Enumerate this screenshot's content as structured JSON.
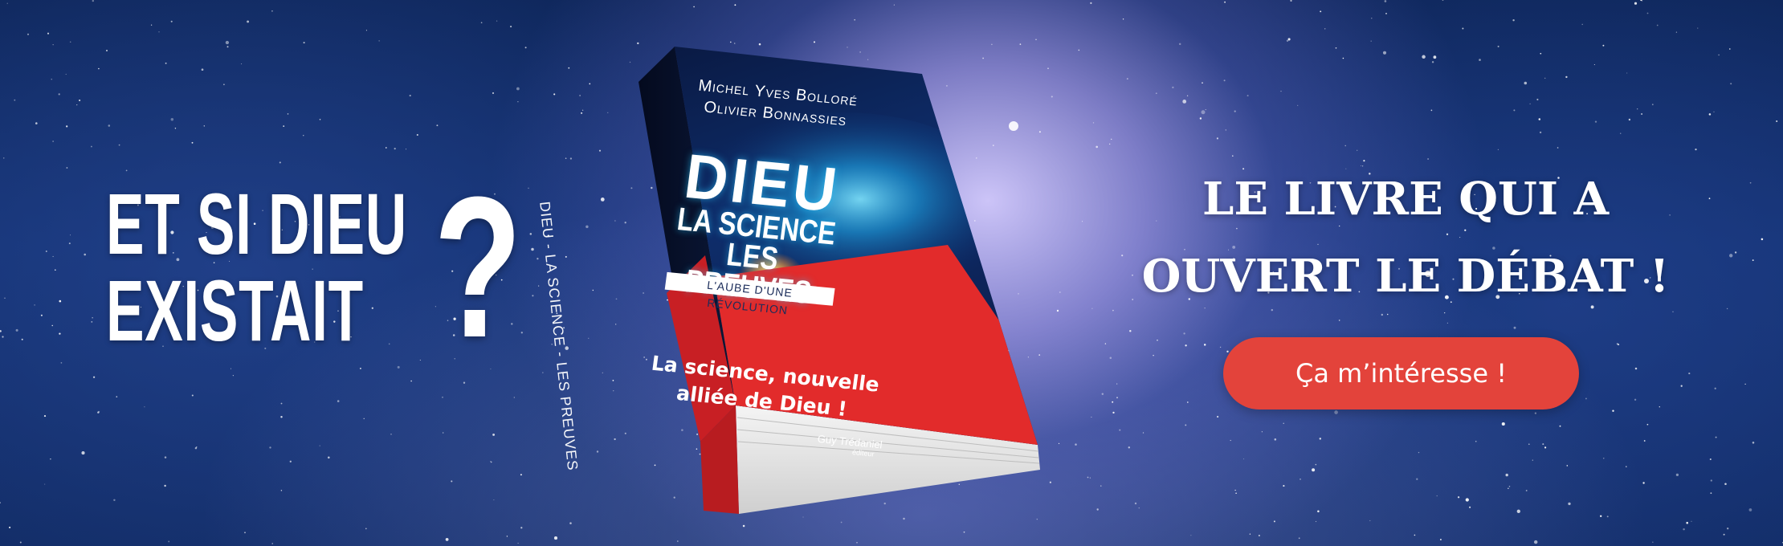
{
  "banner": {
    "headline_left_line1": "ET SI DIEU",
    "headline_left_line2": "EXISTAIT",
    "question_mark": "?",
    "headline_right_line1": "LE LIVRE QUI A",
    "headline_right_line2": "OUVERT LE DÉBAT !",
    "cta_label": "Ça m’intéresse !"
  },
  "book": {
    "author1": "Michel Yves Bolloré",
    "author2": "Olivier Bonnassies",
    "title_line1": "DIEU",
    "title_line2": "LA SCIENCE",
    "title_line3": "LES PREUVES",
    "subtitle": "L'AUBE D'UNE RÉVOLUTION",
    "tagline_line1": "La science, nouvelle",
    "tagline_line2": "alliée de Dieu !",
    "publisher": "Guy Trédaniel",
    "publisher_sub": "éditeur",
    "spine": "DIEU - LA SCIENCE - LES PREUVES"
  },
  "colors": {
    "background": "#123070",
    "cta": "#e3433b",
    "book_red": "#e22b2b",
    "book_cover_top": "#0b1b45"
  }
}
